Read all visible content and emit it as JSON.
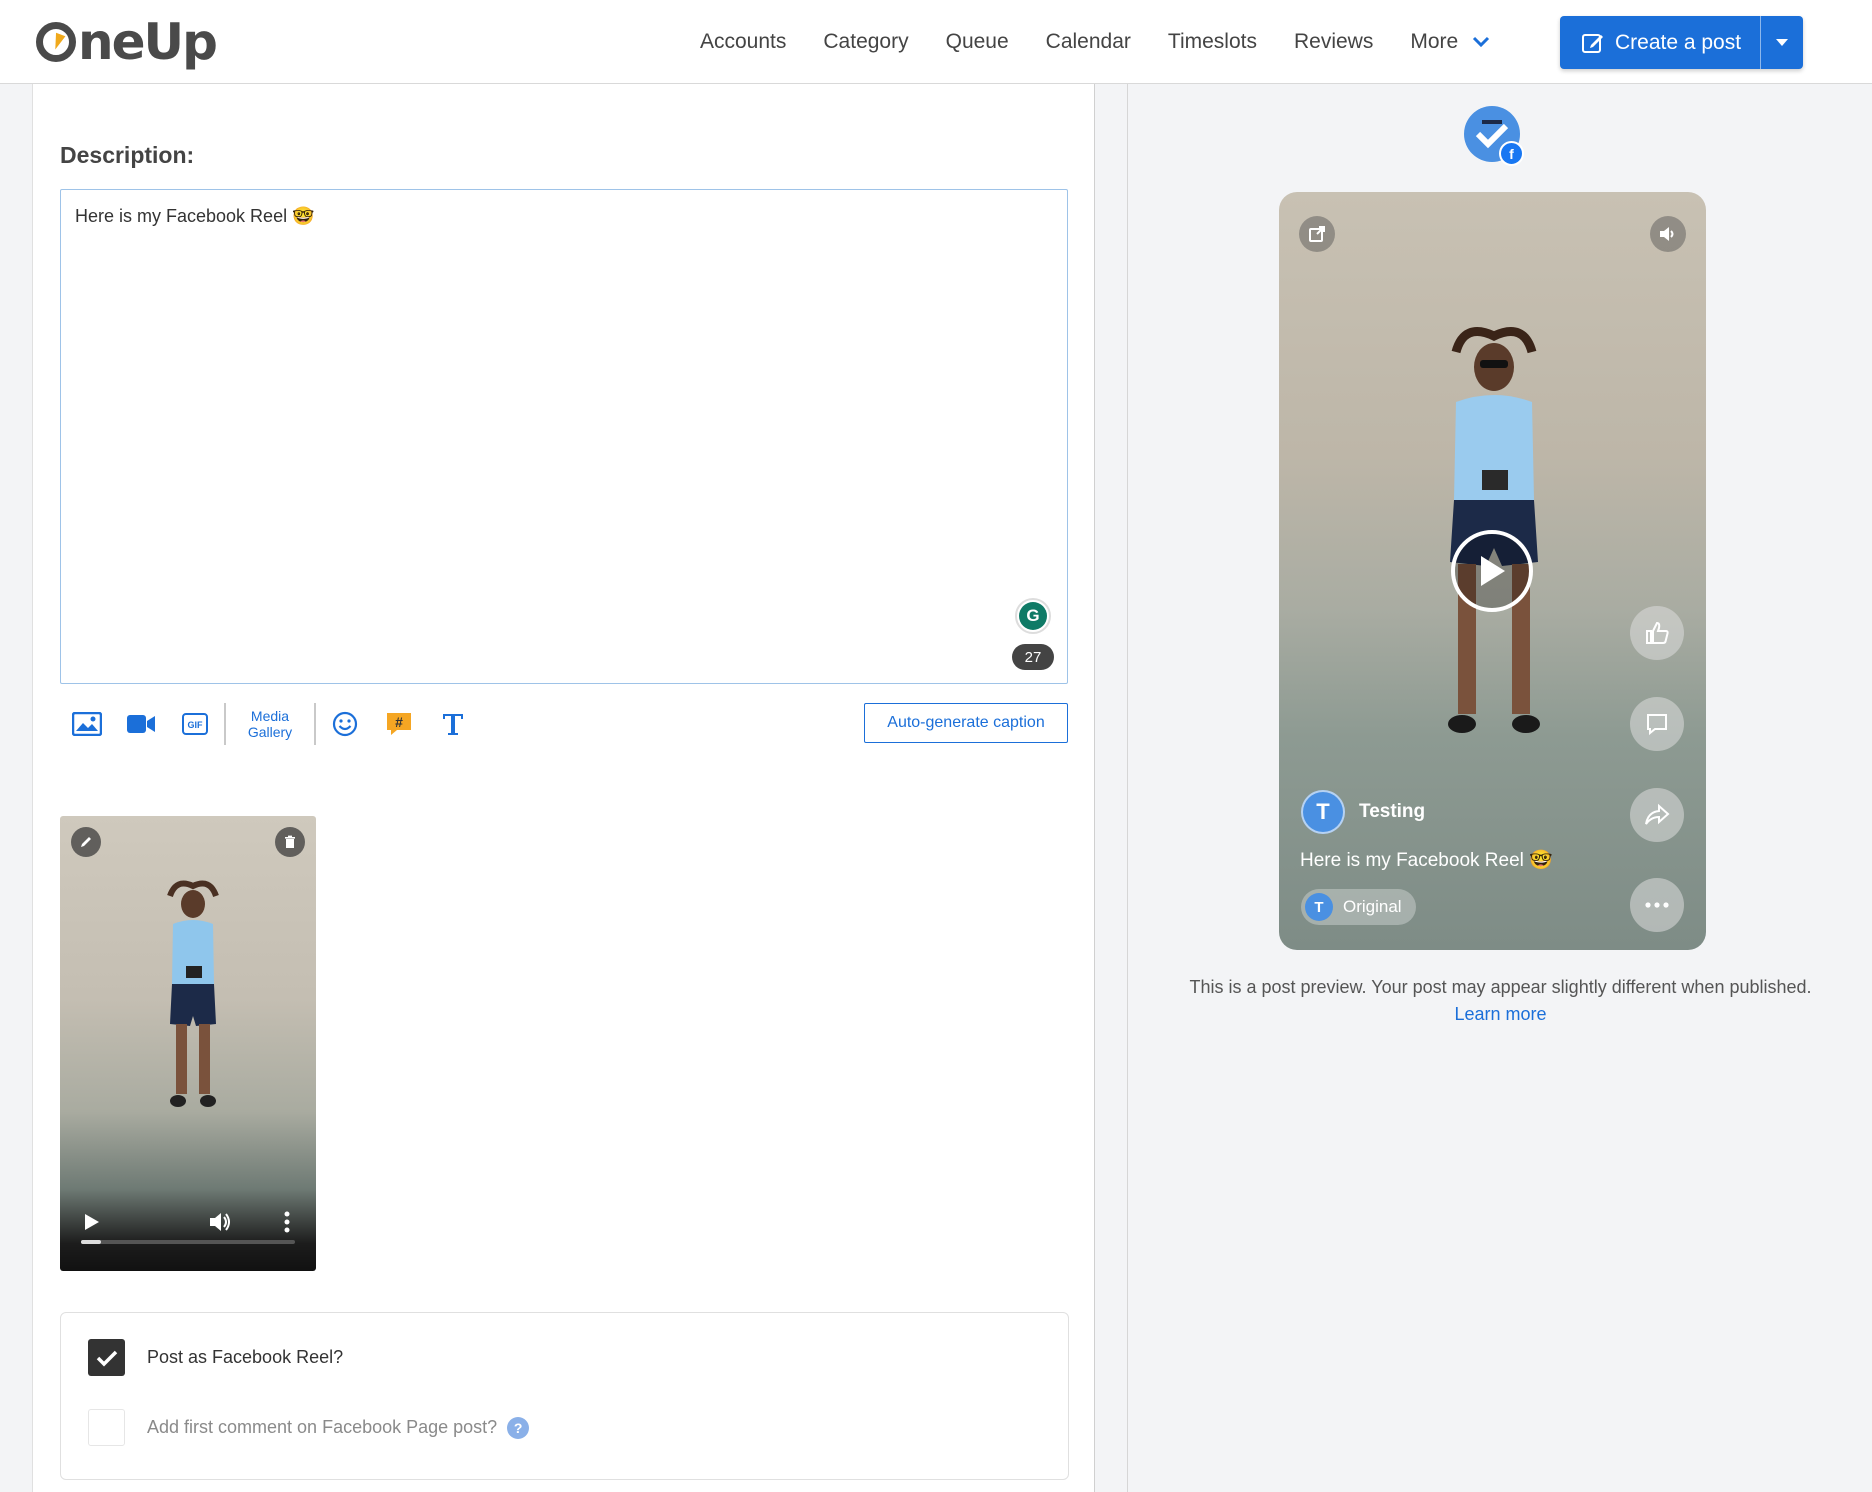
{
  "header": {
    "logo_text": "OneUp",
    "nav": [
      "Accounts",
      "Category",
      "Queue",
      "Calendar",
      "Timeslots",
      "Reviews"
    ],
    "more_label": "More",
    "create_label": "Create a post"
  },
  "editor": {
    "description_label": "Description:",
    "text": "Here is my Facebook Reel 🤓",
    "char_count": "27",
    "media_gallery_label_1": "Media",
    "media_gallery_label_2": "Gallery",
    "auto_caption_label": "Auto-generate caption"
  },
  "options": {
    "reel_label": "Post as Facebook Reel?",
    "reel_checked": true,
    "first_comment_label": "Add first comment on Facebook Page post?",
    "first_comment_checked": false
  },
  "preview": {
    "account_initial": "T",
    "reel_user_name": "Testing",
    "reel_caption": "Here is my Facebook Reel 🤓",
    "reel_audio": "Original",
    "note": "This is a post preview. Your post may appear slightly different when published.",
    "learn_more": "Learn more"
  },
  "colors": {
    "accent": "#1b6fd9",
    "facebook": "#1877f2",
    "avatar": "#4a90e2"
  }
}
